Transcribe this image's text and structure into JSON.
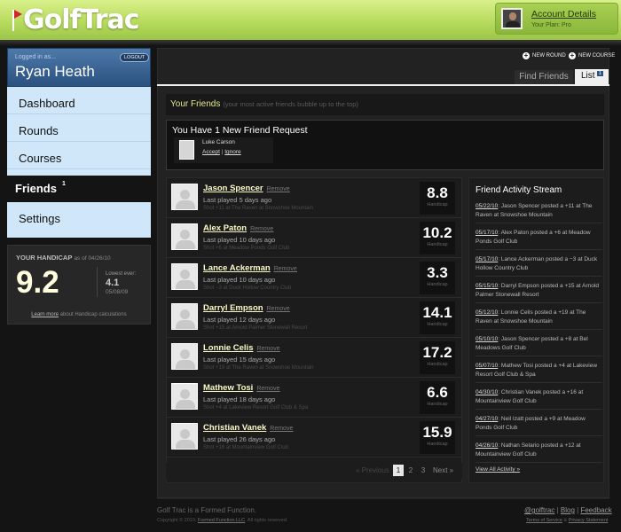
{
  "app": {
    "logo_text": "GolfTrac"
  },
  "account": {
    "link": "Account Details",
    "plan": "Your Plan: Pro"
  },
  "user": {
    "logged_in_label": "Logged in as...",
    "name": "Ryan Heath",
    "logout": "LOGOUT"
  },
  "nav": {
    "items": [
      {
        "label": "Dashboard"
      },
      {
        "label": "Rounds"
      },
      {
        "label": "Courses"
      },
      {
        "label": "Friends",
        "badge": "1"
      },
      {
        "label": "Settings"
      }
    ]
  },
  "handicap": {
    "label": "YOUR HANDICAP",
    "as_of": "as of 04/26/10",
    "value": "9.2",
    "lowest_label": "Lowest ever:",
    "lowest_value": "4.1",
    "lowest_date": "05/08/09",
    "learn_link": "Learn more",
    "learn_rest": "about Handicap calculations"
  },
  "actions": {
    "new_round": "NEW ROUND",
    "new_course": "NEW COURSE"
  },
  "tabs": {
    "find": "Find Friends",
    "list": "List",
    "list_count": "1"
  },
  "friends_header": {
    "title": "Your Friends",
    "subtitle": "(your most active friends bubble up to the top)"
  },
  "request": {
    "title": "You Have 1 New Friend Request",
    "name": "Luke Carson",
    "accept": "Accept",
    "sep": "|",
    "ignore": "Ignore"
  },
  "friends": [
    {
      "name": "Jason Spencer",
      "remove": "Remove",
      "last": "Last played 5 days ago",
      "shot": "Shot +11 at The Raven at Snowshoe Mountain",
      "handicap": "8.8",
      "hc_label": "Handicap"
    },
    {
      "name": "Alex Paton",
      "remove": "Remove",
      "last": "Last played 10 days ago",
      "shot": "Shot +6 at Meadow Ponds Golf Club",
      "handicap": "10.2",
      "hc_label": "Handicap"
    },
    {
      "name": "Lance Ackerman",
      "remove": "Remove",
      "last": "Last played 10 days ago",
      "shot": "Shot −3 at Duck Hollow Country Club",
      "handicap": "3.3",
      "hc_label": "Handicap"
    },
    {
      "name": "Darryl Empson",
      "remove": "Remove",
      "last": "Last played 12 days ago",
      "shot": "Shot +15 at Arnold Palmer Stonewall Resort",
      "handicap": "14.1",
      "hc_label": "Handicap"
    },
    {
      "name": "Lonnie Celis",
      "remove": "Remove",
      "last": "Last played 15 days ago",
      "shot": "Shot +19 at The Raven at Snowshoe Mountain",
      "handicap": "17.2",
      "hc_label": "Handicap"
    },
    {
      "name": "Mathew Tosi",
      "remove": "Remove",
      "last": "Last played 18 days ago",
      "shot": "Shot +4 at Lakeview Resort Golf Club & Spa",
      "handicap": "6.6",
      "hc_label": "Handicap"
    },
    {
      "name": "Christian Vanek",
      "remove": "Remove",
      "last": "Last played 26 days ago",
      "shot": "Shot +16 at Mountainview Golf Club",
      "handicap": "15.9",
      "hc_label": "Handicap"
    }
  ],
  "pagination": {
    "prev": "« Previous",
    "pages": [
      "1",
      "2",
      "3"
    ],
    "next": "Next »"
  },
  "stream": {
    "title": "Friend Activity Stream",
    "items": [
      {
        "date": "05/22/10",
        "text": ": Jason Spencer posted a +11 at The Raven at Snowshoe Mountain"
      },
      {
        "date": "05/17/10",
        "text": ": Alex Paton posted a +6 at Meadow Ponds Golf Club"
      },
      {
        "date": "05/17/10",
        "text": ": Lance Ackerman posted a −3 at Duck Hollow Country Club"
      },
      {
        "date": "05/15/10",
        "text": ": Darryl Empson posted a +15 at Arnold Palmer Stonewall Resort"
      },
      {
        "date": "05/12/10",
        "text": ": Lonnie Celis posted a +19 at The Raven at Snowshoe Mountain"
      },
      {
        "date": "05/10/10",
        "text": ": Jason Spencer posted a +8 at Bel Meadows Golf Club"
      },
      {
        "date": "05/07/10",
        "text": ": Mathew Tosi posted a +4 at Lakeview Resort Golf Club & Spa"
      },
      {
        "date": "04/30/10",
        "text": ": Christian Vanek posted a +16 at Mountainview Golf Club"
      },
      {
        "date": "04/27/10",
        "text": ": Neil Izatt posted a +9 at Meadow Ponds Golf Club"
      },
      {
        "date": "04/26/10",
        "text": ": Nathan Selario posted a +12 at Mountainview Golf Club"
      }
    ],
    "view_all": "View All Activity »"
  },
  "footer": {
    "brand": "Golf Trac is a Formed Function.",
    "copy_pre": "Copyright © 2010,",
    "copy_link": "Formed Function LLC",
    "copy_post": ". All rights reserved.",
    "twitter": "@golftrac",
    "blog": "Blog",
    "feedback": "Feedback",
    "sep": "|",
    "terms": "Terms of Service",
    "amp": "&",
    "privacy": "Privacy Statement"
  },
  "colors": {
    "header_green": "#b4d95a",
    "nav_blue": "#cfe7f9",
    "user_blue": "#2b5281",
    "accent_yellow": "#e2e88e"
  }
}
